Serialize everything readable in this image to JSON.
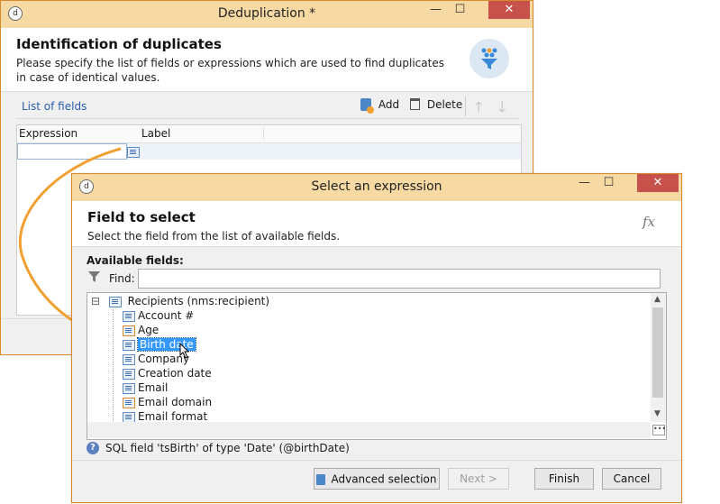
{
  "dedup_window": {
    "title": "Deduplication *",
    "minimize": "—",
    "maximize": "☐",
    "close": "✕",
    "header_title": "Identification of duplicates",
    "header_desc": "Please specify the list of fields or expressions which are used to find duplicates in case of identical values.",
    "list_label": "List of fields",
    "add_label": "Add",
    "delete_label": "Delete",
    "columns": [
      "Expression",
      "Label"
    ]
  },
  "expr_window": {
    "title": "Select an expression",
    "minimize": "—",
    "maximize": "☐",
    "close": "✕",
    "header_title": "Field to select",
    "header_desc": "Select the field from the list of available fields.",
    "fx": "fx",
    "available_label": "Available fields:",
    "find_label": "Find:",
    "find_value": "",
    "tree_root": "Recipients (nms:recipient)",
    "tree_toggle": "⊟",
    "tree_items": [
      {
        "label": "Account #",
        "icon": "field-icon"
      },
      {
        "label": "Age",
        "icon": "computed-field-icon"
      },
      {
        "label": "Birth date",
        "icon": "field-icon",
        "selected": true
      },
      {
        "label": "Company",
        "icon": "field-icon"
      },
      {
        "label": "Creation date",
        "icon": "field-icon"
      },
      {
        "label": "Email",
        "icon": "field-icon"
      },
      {
        "label": "Email domain",
        "icon": "computed-field-icon"
      },
      {
        "label": "Email format",
        "icon": "field-icon"
      }
    ],
    "sql_info": "SQL field 'tsBirth' of type 'Date' (@birthDate)",
    "advanced_label": "Advanced selection",
    "next_label": "Next >",
    "finish_label": "Finish",
    "cancel_label": "Cancel"
  },
  "colors": {
    "titlebar": "#f7d9a3",
    "close": "#c7514b",
    "arrow": "#f0a030",
    "selection": "#3399ff",
    "link": "#2a5db0"
  }
}
